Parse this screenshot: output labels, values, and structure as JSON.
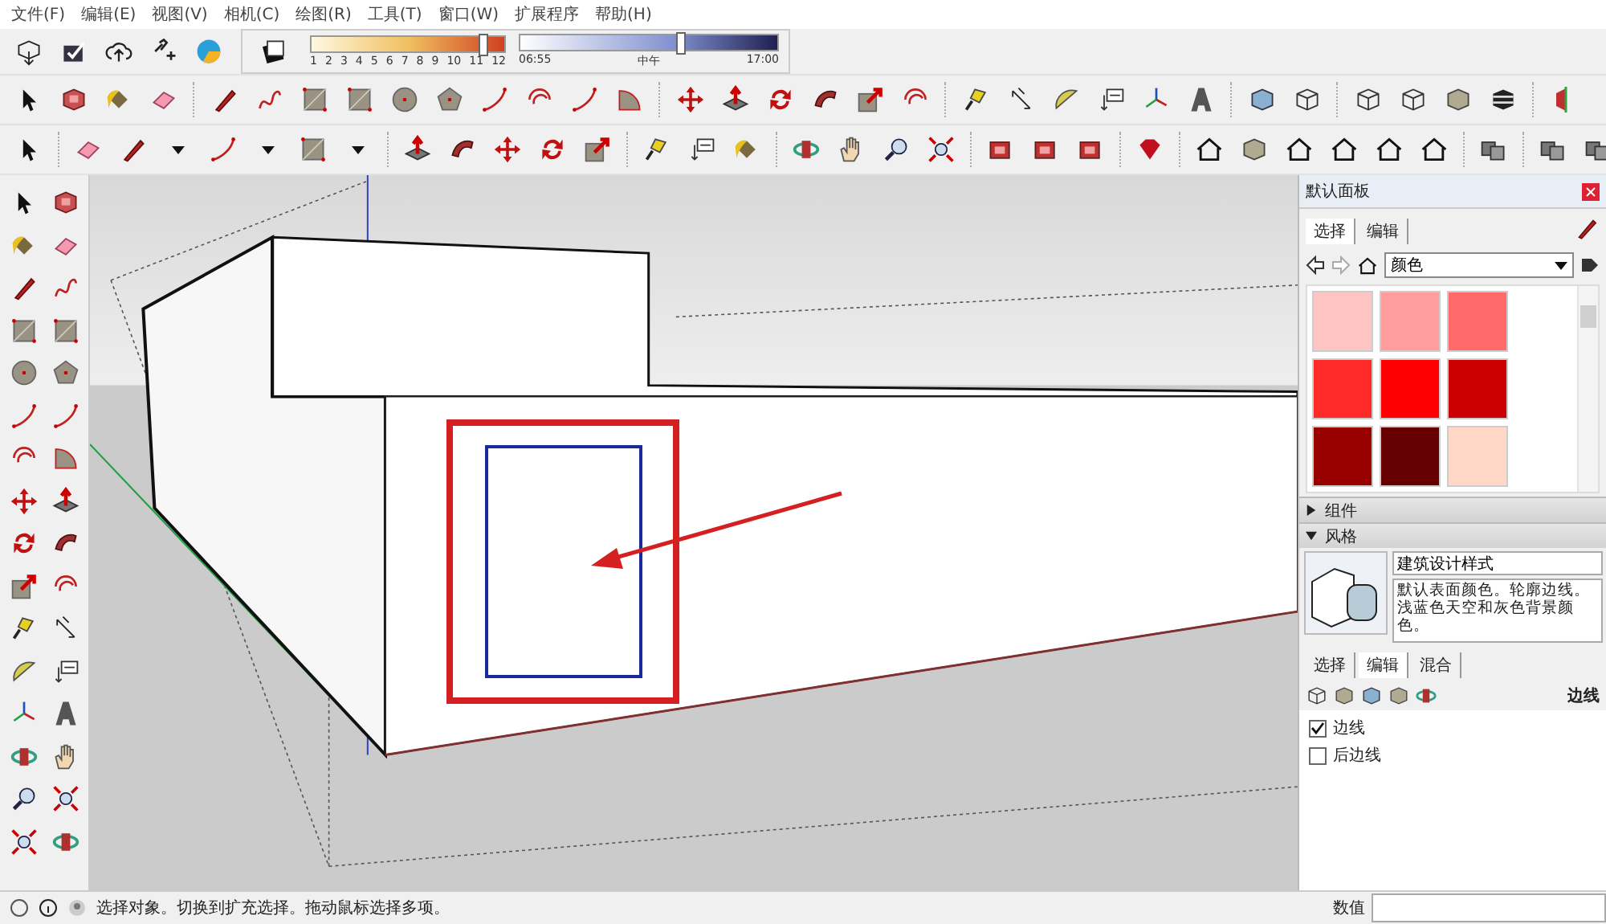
{
  "menu": [
    {
      "label": "文件(F)"
    },
    {
      "label": "编辑(E)"
    },
    {
      "label": "视图(V)"
    },
    {
      "label": "相机(C)"
    },
    {
      "label": "绘图(R)"
    },
    {
      "label": "工具(T)"
    },
    {
      "label": "窗口(W)"
    },
    {
      "label": "扩展程序"
    },
    {
      "label": "帮助(H)"
    }
  ],
  "month_slider": {
    "labels": [
      "1",
      "2",
      "3",
      "4",
      "5",
      "6",
      "7",
      "8",
      "9",
      "10",
      "11",
      "12"
    ],
    "level": 0.88
  },
  "time_slider": {
    "labels": [
      "06:55",
      "中午",
      "17:00"
    ],
    "level": 0.62
  },
  "tray": {
    "title": "默认面板",
    "materials": {
      "tabs": [
        {
          "label": "选择",
          "selected": true
        },
        {
          "label": "编辑",
          "selected": false
        }
      ],
      "library": "颜色",
      "swatches": [
        {
          "color": "#ffc4c4"
        },
        {
          "color": "#ff9c9c"
        },
        {
          "color": "#ff6a6a"
        },
        {
          "color": "#ff2a2a"
        },
        {
          "color": "#ff0000"
        },
        {
          "color": "#cc0000"
        },
        {
          "color": "#990000"
        },
        {
          "color": "#660000"
        },
        {
          "color": "#ffd8c8"
        }
      ]
    },
    "sections": [
      {
        "label": "组件",
        "expanded": false
      },
      {
        "label": "风格",
        "expanded": true
      }
    ],
    "style": {
      "name": "建筑设计样式",
      "description": "默认表面颜色。轮廓边线。浅蓝色天空和灰色背景颜色。",
      "tabs": [
        {
          "label": "选择",
          "selected": false
        },
        {
          "label": "编辑",
          "selected": true
        },
        {
          "label": "混合",
          "selected": false
        }
      ],
      "edit_heading": "边线",
      "options": [
        {
          "label": "边线",
          "checked": true
        },
        {
          "label": "后边线",
          "checked": false
        }
      ]
    }
  },
  "status_bar": {
    "message": "选择对象。切换到扩充选择。拖动鼠标选择多项。",
    "measurements_label": "数值"
  }
}
